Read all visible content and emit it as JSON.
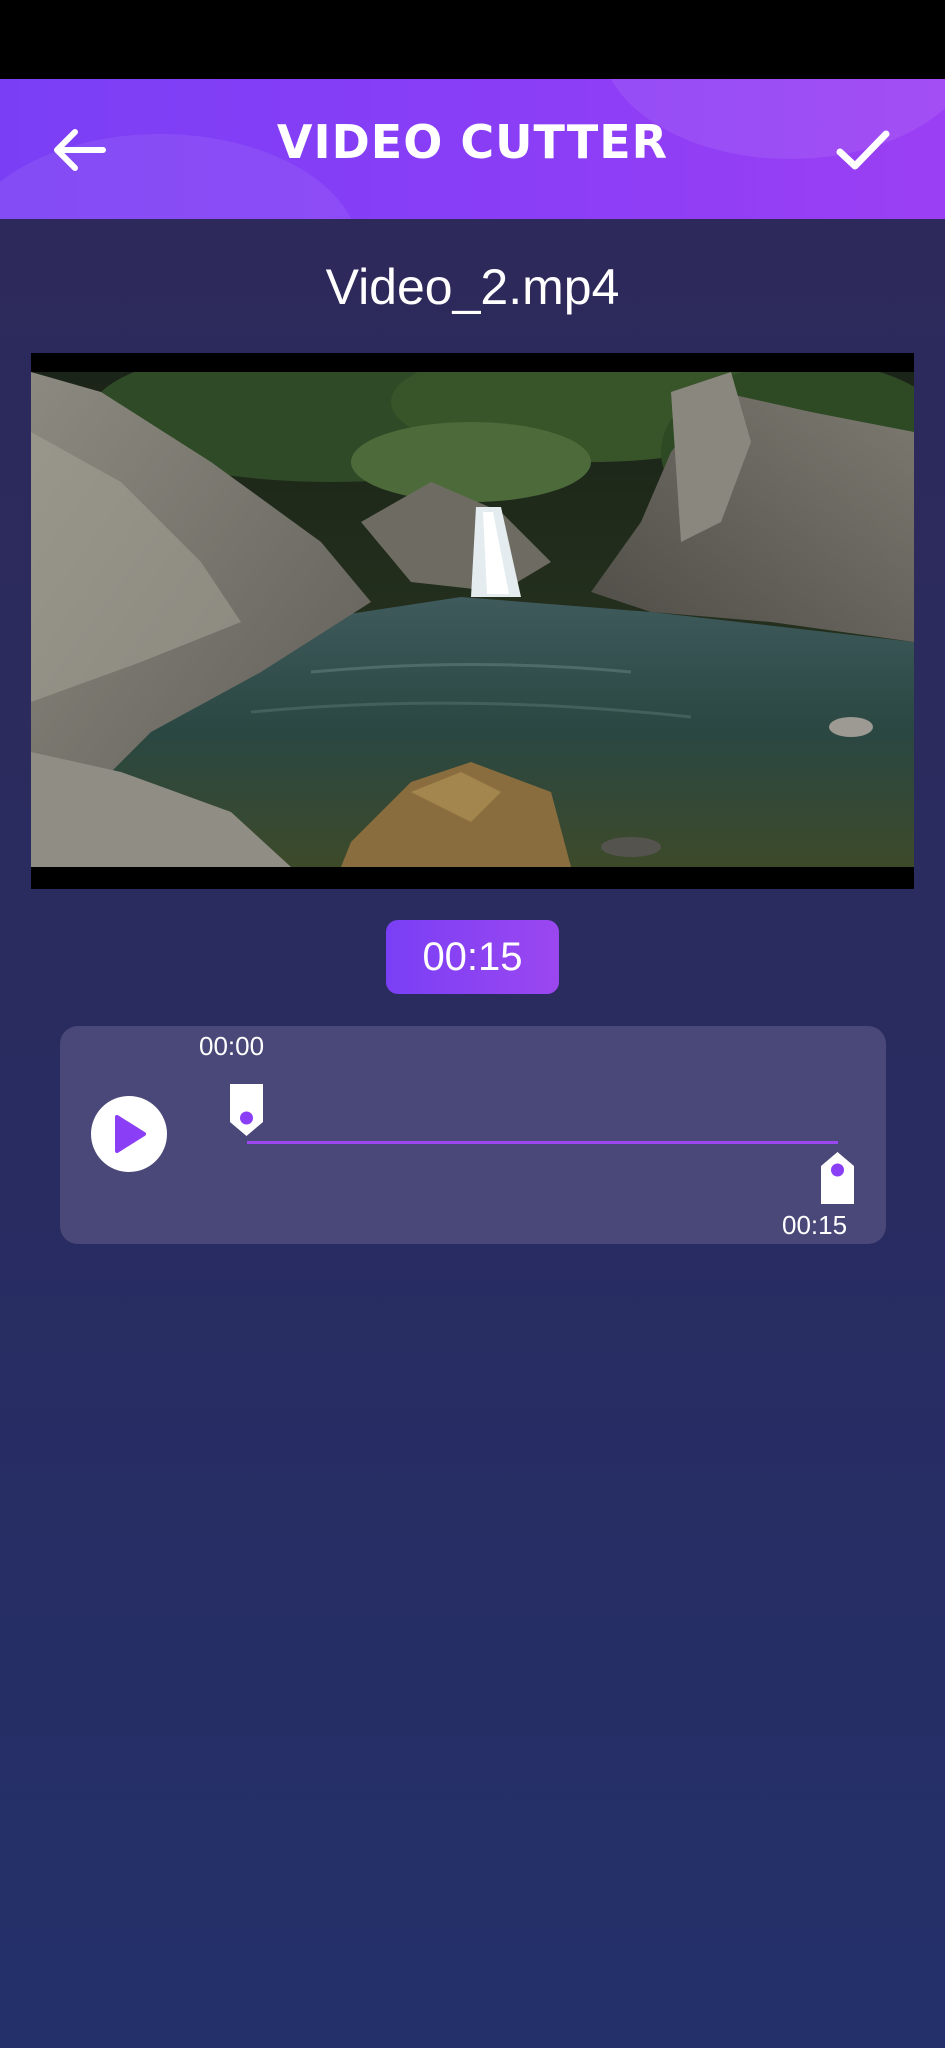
{
  "header": {
    "title": "VIDEO CUTTER",
    "back_icon": "arrow-left-icon",
    "confirm_icon": "checkmark-icon",
    "accent_color": "#8a3ef6"
  },
  "file": {
    "name": "Video_2.mp4"
  },
  "player": {
    "duration": "00:15",
    "play_icon": "play-icon"
  },
  "trimmer": {
    "start_time": "00:00",
    "end_time": "00:15",
    "start_fraction": 0,
    "end_fraction": 1,
    "track_color": "#9b47f0"
  }
}
